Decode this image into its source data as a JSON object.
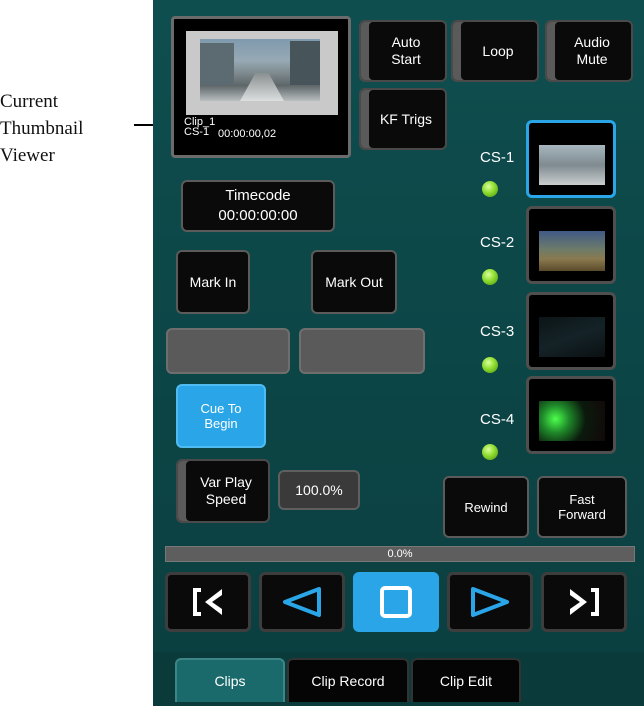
{
  "callout": {
    "line1": "Current",
    "line2": "Thumbnail",
    "line3": "Viewer"
  },
  "viewer": {
    "clip_name": "Clip_1",
    "cs_name": "CS-1",
    "timecode": "00:00:00,02"
  },
  "buttons": {
    "auto_start": [
      "Auto",
      "Start"
    ],
    "loop": "Loop",
    "audio_mute": [
      "Audio",
      "Mute"
    ],
    "kf_trigs": "KF Trigs",
    "timecode": [
      "Timecode",
      "00:00:00:00"
    ],
    "mark_in": "Mark In",
    "mark_out": "Mark Out",
    "cue_to_begin": [
      "Cue To",
      "Begin"
    ],
    "var_play_speed": [
      "Var Play",
      "Speed"
    ],
    "rewind": "Rewind",
    "fast_forward": [
      "Fast",
      "Forward"
    ]
  },
  "var_play_speed_value": "100.0%",
  "channels": [
    {
      "label": "CS-1",
      "selected": true
    },
    {
      "label": "CS-2",
      "selected": false
    },
    {
      "label": "CS-3",
      "selected": false
    },
    {
      "label": "CS-4",
      "selected": false
    }
  ],
  "progress": {
    "label": "0.0%",
    "value": 0.0
  },
  "transport": [
    "skip-to-start-icon",
    "reverse-play-icon",
    "stop-icon",
    "play-icon",
    "skip-to-end-icon"
  ],
  "tabs": [
    {
      "label": "Clips",
      "active": true
    },
    {
      "label": "Clip Record",
      "active": false
    },
    {
      "label": "Clip Edit",
      "active": false
    }
  ],
  "colors": {
    "accent": "#2aa6e8",
    "panel": "#0f4e4f",
    "led": "#8ddc2f"
  }
}
